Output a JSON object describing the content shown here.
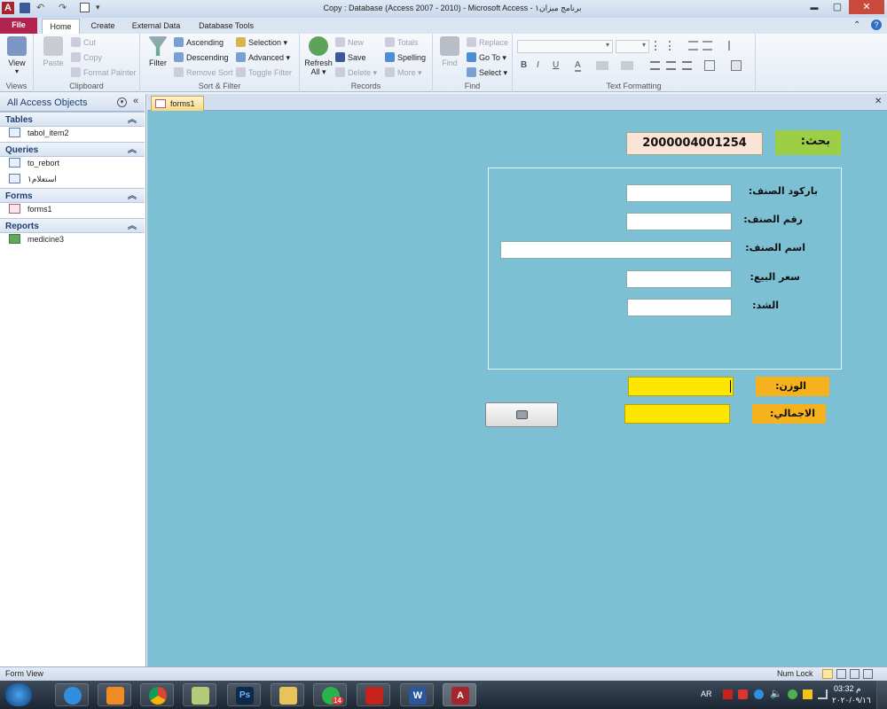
{
  "window": {
    "title": "برنامج ميزان١ - Copy : Database (Access 2007 - 2010)  -  Microsoft Access",
    "app_letter": "A",
    "controls": {
      "minimize": "▬",
      "maximize": "▢",
      "close": "✕"
    }
  },
  "ribbon_tabs": [
    {
      "label": "File"
    },
    {
      "label": "Home"
    },
    {
      "label": "Create"
    },
    {
      "label": "External Data"
    },
    {
      "label": "Database Tools"
    }
  ],
  "ribbon": {
    "views": {
      "view_label": "View",
      "group": "Views"
    },
    "clipboard": {
      "paste": "Paste",
      "cut": "Cut",
      "copy": "Copy",
      "format_painter": "Format Painter",
      "group": "Clipboard"
    },
    "sort_filter": {
      "filter": "Filter",
      "ascending": "Ascending",
      "descending": "Descending",
      "remove_sort": "Remove Sort",
      "selection": "Selection",
      "advanced": "Advanced",
      "toggle_filter": "Toggle Filter",
      "group": "Sort & Filter"
    },
    "records": {
      "refresh": "Refresh",
      "refresh_all": "All",
      "new": "New",
      "save": "Save",
      "delete": "Delete",
      "totals": "Totals",
      "spelling": "Spelling",
      "more": "More",
      "group": "Records"
    },
    "find": {
      "find": "Find",
      "replace": "Replace",
      "go_to": "Go To",
      "select": "Select",
      "group": "Find"
    },
    "text_formatting": {
      "bold": "B",
      "italic": "I",
      "underline": "U",
      "font_color": "A",
      "group": "Text Formatting"
    }
  },
  "nav_pane": {
    "title": "All Access Objects",
    "sections": [
      {
        "header": "Tables",
        "items": [
          "tabol_item2"
        ]
      },
      {
        "header": "Queries",
        "items": [
          "to_rebort",
          "استعلام١"
        ]
      },
      {
        "header": "Forms",
        "items": [
          "forms1"
        ]
      },
      {
        "header": "Reports",
        "items": [
          "medicine3"
        ]
      }
    ]
  },
  "document_tab": {
    "label": "forms1"
  },
  "form": {
    "search": {
      "label": "بحث:",
      "value": "2000004001254"
    },
    "fields": [
      {
        "label": "باركود الصنف:",
        "value": ""
      },
      {
        "label": "رقم الصنف:",
        "value": ""
      },
      {
        "label": "اسم الصنف:",
        "value": ""
      },
      {
        "label": "سعر البيع:",
        "value": ""
      },
      {
        "label": "الشد:",
        "value": ""
      }
    ],
    "weight": {
      "label": "الوزن:",
      "value": ""
    },
    "total": {
      "label": "الاجمالي:",
      "value": ""
    },
    "colors": {
      "background": "#7dbfd3",
      "search_label_bg": "#9ccf45",
      "search_field_bg": "#fbe4d5",
      "yellow": "#ffe600",
      "orange_label": "#f5b21c"
    }
  },
  "status_bar": {
    "left": "Form View",
    "num_lock": "Num Lock"
  },
  "taskbar": {
    "apps": [
      "ie-icon",
      "media-player-icon",
      "chrome-icon",
      "notepad-icon",
      "photoshop-icon",
      "explorer-icon",
      "whatsapp-icon",
      "acrobat-icon",
      "word-icon",
      "access-icon"
    ],
    "whatsapp_badge": "14",
    "language": "AR",
    "time": "03:32 م",
    "date": "٢٠٢٠/٠٩/١٦"
  }
}
